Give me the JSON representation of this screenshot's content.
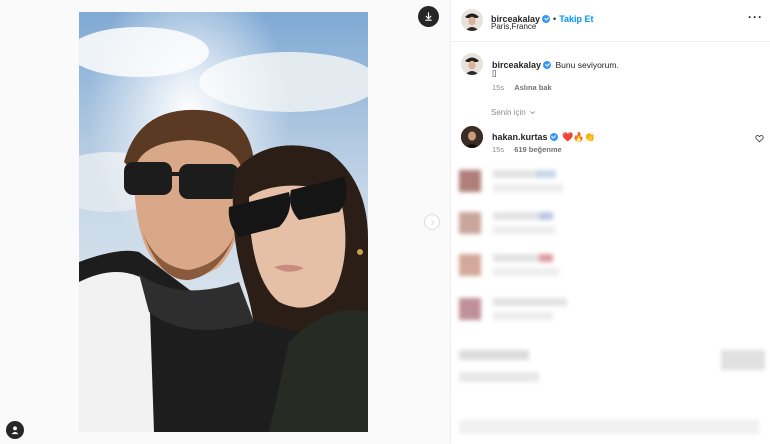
{
  "post": {
    "author": {
      "username": "birceakalay",
      "verified": true,
      "follow_label": "Takip Et",
      "location": "Paris,France"
    },
    "caption": {
      "username": "birceakalay",
      "text": "Bunu seviyorum.",
      "second_line_glyph": "▯",
      "time": "15s",
      "see_translation": "Aslına bak"
    },
    "comments_filter": "Senin için",
    "comments": [
      {
        "username": "hakan.kurtas",
        "verified": true,
        "text": "❤️🔥👏",
        "time": "15s",
        "likes": "619 beğenme"
      }
    ],
    "more_icon": "more-horizontal-icon",
    "download_icon": "download-icon",
    "user_tag_icon": "user-icon",
    "next_icon": "chevron-right-icon",
    "like_icon": "heart-icon"
  },
  "colors": {
    "accent": "#0095f6",
    "verified": "#3897f0",
    "text": "#262626",
    "muted": "#8e8e8e"
  }
}
